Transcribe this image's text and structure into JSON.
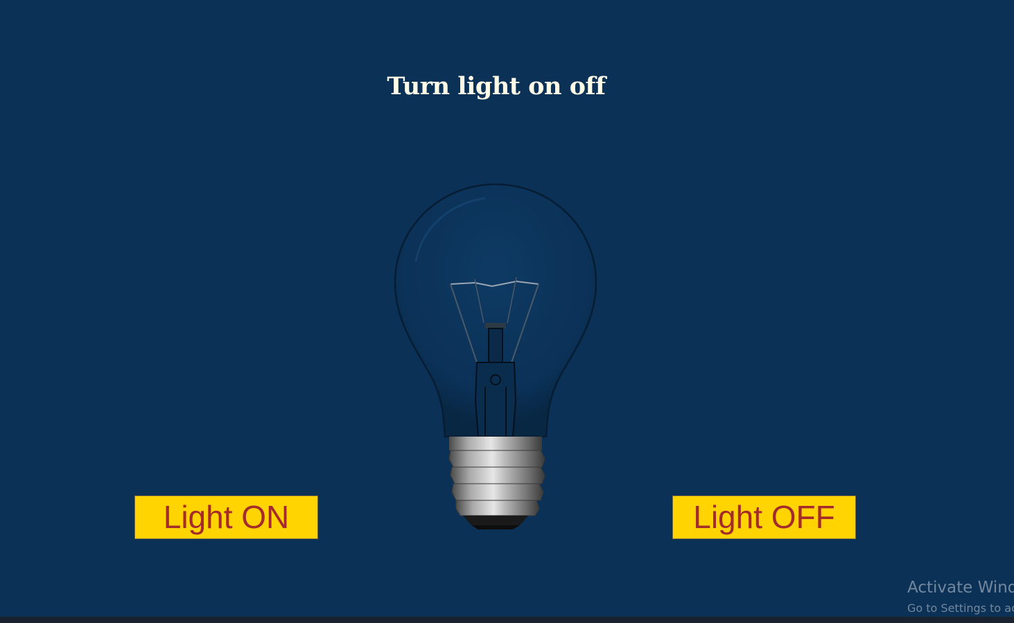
{
  "page": {
    "title": "Turn light on off",
    "background_color": "#0b3157"
  },
  "bulb": {
    "state": "off",
    "icon": "light-bulb-icon"
  },
  "buttons": {
    "on_label": "Light ON",
    "off_label": "Light OFF",
    "background_color": "#ffd400",
    "text_color": "#a52a2a"
  },
  "watermark": {
    "line1": "Activate Windows",
    "line2": "Go to Settings to activate Windows."
  }
}
